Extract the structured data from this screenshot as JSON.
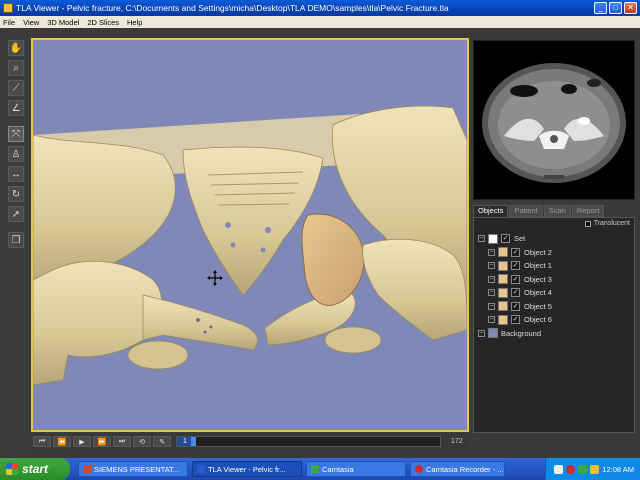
{
  "window": {
    "title": "TLA Viewer - Pelvic fracture, C:\\Documents and Settings\\micha\\Desktop\\TLA DEMO\\samples\\tla\\Pelvic Fracture.tla",
    "minimize": "_",
    "maximize": "□",
    "close": "✕"
  },
  "menu": [
    "File",
    "View",
    "3D Model",
    "2D Slices",
    "Help"
  ],
  "toolbar": {
    "tools": [
      "hand-icon",
      "zoom-icon",
      "line-measure-icon",
      "angle-measure-icon",
      "rotate-3d-icon",
      "person-view-icon",
      "pan-horizontal-icon",
      "rotate-icon",
      "pointer-icon",
      "layers-icon"
    ]
  },
  "tabs": [
    "Objects",
    "Patient",
    "Scan",
    "Report"
  ],
  "panel": {
    "translucent_label": "Translucent",
    "tree": [
      {
        "label": "Set",
        "color": "#ffffff",
        "level": 0
      },
      {
        "label": "Object 2",
        "color": "#e6c58f",
        "level": 1
      },
      {
        "label": "Object 1",
        "color": "#e6c58f",
        "level": 1
      },
      {
        "label": "Object 3",
        "color": "#e6c58f",
        "level": 1
      },
      {
        "label": "Object 4",
        "color": "#e6c58f",
        "level": 1
      },
      {
        "label": "Object 5",
        "color": "#e6c58f",
        "level": 1
      },
      {
        "label": "Object 6",
        "color": "#e6c58f",
        "level": 1
      },
      {
        "label": "Background",
        "color": "#8088b8",
        "level": 0
      }
    ]
  },
  "playback": {
    "current_frame": "1",
    "total_frames": "172",
    "progress": 0.0
  },
  "taskbar": {
    "start": "start",
    "buttons": [
      {
        "label": "SIEMENS PRESENTAT...",
        "active": false,
        "icon_color": "#d04a2a"
      },
      {
        "label": "TLA Viewer - Pelvic fr...",
        "active": true,
        "icon_color": "#2a5ad0"
      },
      {
        "label": "Camtasia",
        "active": false,
        "icon_color": "#3aa84a"
      },
      {
        "label": "Camtasia Recorder - ...",
        "active": false,
        "icon_color": "#d02a2a"
      }
    ],
    "clock": "12:08 AM"
  },
  "colors": {
    "viewport_bg": "#8088b8",
    "viewport_border": "#e8c640",
    "bone": "#e6d7a6"
  }
}
